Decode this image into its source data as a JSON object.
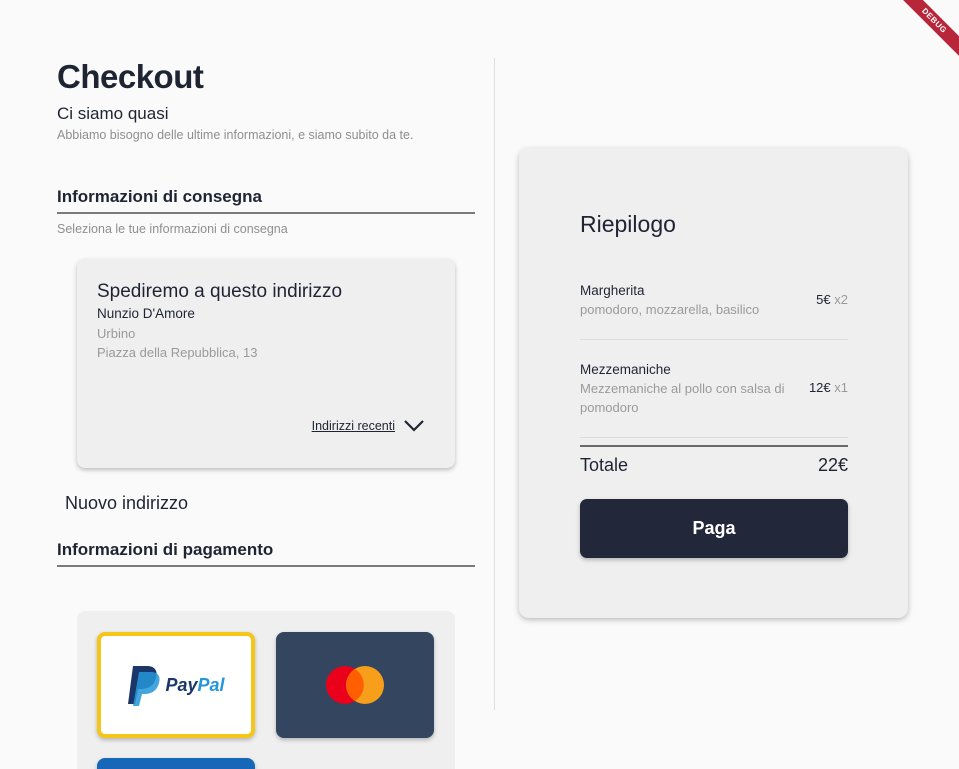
{
  "debug_banner": "DEBUG",
  "checkout": {
    "title": "Checkout",
    "subtitle": "Ci siamo quasi",
    "intro": "Abbiamo bisogno delle ultime informazioni, e siamo subito da te."
  },
  "delivery": {
    "section_title": "Informazioni di consegna",
    "section_subtitle": "Seleziona le tue informazioni di consegna",
    "card": {
      "heading": "Spediremo a questo indirizzo",
      "name": "Nunzio D'Amore",
      "city": "Urbino",
      "street": "Piazza della Repubblica, 13",
      "recent_label": "Indirizzi recenti",
      "recent_icon": "chevron-down-icon"
    },
    "new_address_label": "Nuovo indirizzo"
  },
  "payment": {
    "section_title": "Informazioni di pagamento",
    "methods": [
      {
        "name": "PayPal",
        "logo_text_1": "Pay",
        "logo_text_2": "Pal",
        "selected": true,
        "colors": {
          "dark": "#1b3668",
          "light": "#2597d9",
          "border": "#f5c518"
        }
      },
      {
        "name": "Mastercard",
        "selected": false,
        "colors": {
          "bg": "#344560",
          "red": "#eb001b",
          "orange": "#f79e1b"
        }
      },
      {
        "name": "card-3",
        "selected": false,
        "colors": {
          "bg": "#1667b8"
        }
      }
    ]
  },
  "summary": {
    "title": "Riepilogo",
    "items": [
      {
        "name": "Margherita",
        "description": "pomodoro, mozzarella, basilico",
        "price": "5€",
        "qty": "x2"
      },
      {
        "name": "Mezzemaniche",
        "description": "Mezzemaniche al pollo con salsa di pomodoro",
        "price": "12€",
        "qty": "x1"
      }
    ],
    "total_label": "Totale",
    "total_value": "22€",
    "pay_button": "Paga"
  },
  "colors": {
    "primary_dark": "#22283a",
    "card_bg": "#efefef",
    "page_bg": "#fafafa",
    "muted_text": "#9a9a9a"
  }
}
